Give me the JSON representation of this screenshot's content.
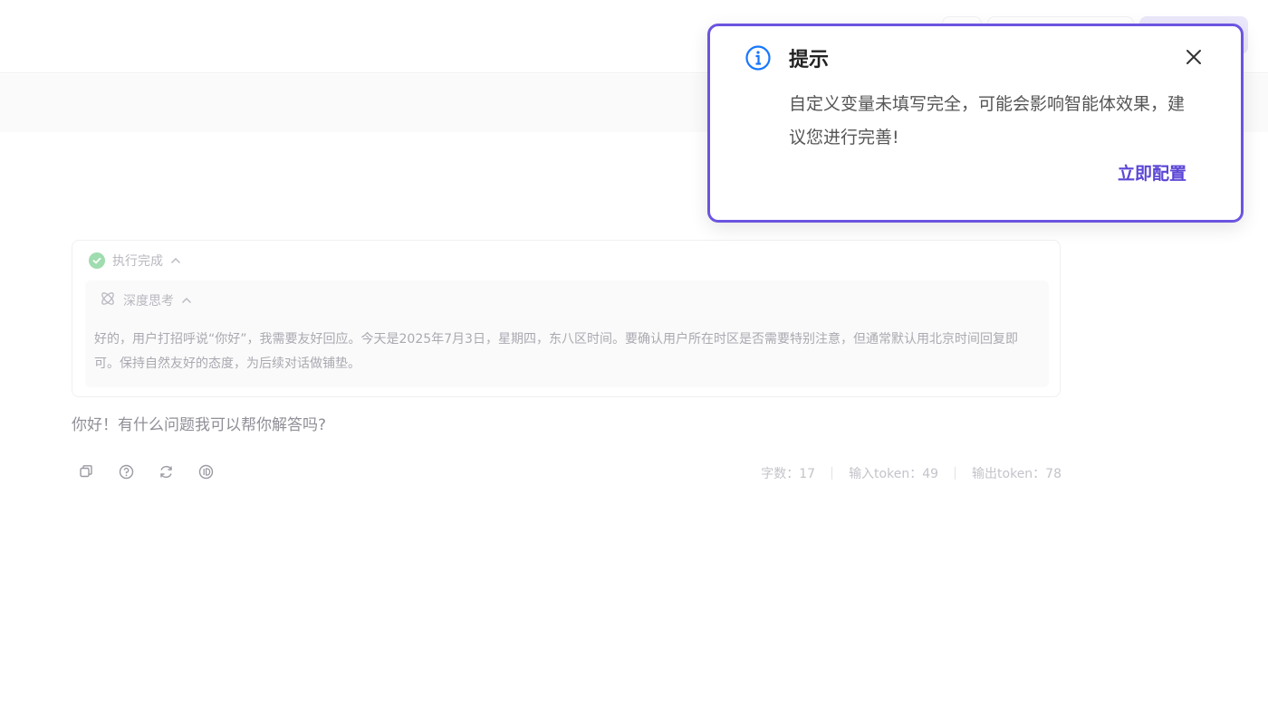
{
  "notice": {
    "icon": "info-icon",
    "title": "提示",
    "message": "自定义变量未填写完全，可能会影响智能体效果，建议您进行完善!",
    "action_label": "立即配置",
    "accent_color": "#6a55e0"
  },
  "execution": {
    "status_label": "执行完成",
    "status_icon": "check-circle-icon",
    "thinking": {
      "label": "深度思考",
      "icon": "thinking-icon",
      "text": "好的，用户打招呼说“你好”，我需要友好回应。今天是2025年7月3日，星期四，东八区时间。要确认用户所在时区是否需要特别注意，但通常默认用北京时间回复即可。保持自然友好的态度，为后续对话做铺垫。"
    }
  },
  "answer": {
    "text": "你好！有什么问题我可以帮你解答吗?"
  },
  "actions": [
    "copy-icon",
    "help-icon",
    "refresh-icon",
    "id-icon"
  ],
  "stats": {
    "chars": "字数：17",
    "input_tokens": "输入token：49",
    "output_tokens": "输出token：78"
  }
}
